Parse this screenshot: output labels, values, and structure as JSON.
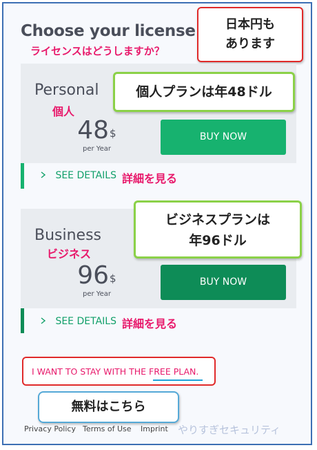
{
  "header": {
    "title": "Choose your license",
    "subtitle_jp": "ライセンスはどうしますか？"
  },
  "callouts": {
    "yen_line1": "日本円も",
    "yen_line2": "あります",
    "personal_price": "個人プランは年48ドル",
    "business_line1": "ビジネスプランは",
    "business_line2": "年96ドル",
    "free_plan": "無料はこちら"
  },
  "plans": {
    "personal": {
      "name": "Personal",
      "name_jp": "個人",
      "price": "48",
      "currency": "$",
      "period": "per Year",
      "buy_label": "BUY NOW",
      "details_label": "SEE DETAILS",
      "details_jp": "詳細を見る"
    },
    "business": {
      "name": "Business",
      "name_jp": "ビジネス",
      "price": "96",
      "currency": "$",
      "period": "per Year",
      "buy_label": "BUY NOW",
      "details_label": "SEE DETAILS",
      "details_jp": "詳細を見る"
    }
  },
  "free_plan": {
    "prefix": "I WANT TO STAY WITH THE ",
    "link": "FREE PLAN",
    "suffix": "."
  },
  "footer": {
    "privacy": "Privacy Policy",
    "terms": "Terms of Use",
    "imprint": "Imprint",
    "watermark": "やりすぎセキュリティ"
  },
  "colors": {
    "accent_green": "#12a06a",
    "buy_personal": "#17b26f",
    "buy_business": "#0e8c57",
    "annotation_pink": "#e8196b"
  },
  "icons": {
    "details_chevron": "chevron-right-icon"
  }
}
